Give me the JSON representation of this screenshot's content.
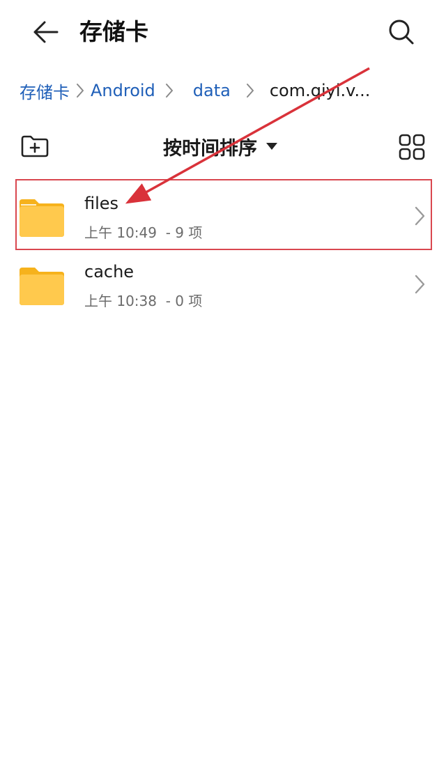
{
  "header": {
    "title": "存储卡",
    "back_icon": "arrow-left-icon",
    "search_icon": "search-icon"
  },
  "breadcrumb": {
    "items": [
      {
        "label": "存储卡"
      },
      {
        "label": "Android"
      },
      {
        "label": "data"
      },
      {
        "label": "com.qiyi.v..."
      }
    ]
  },
  "toolbar": {
    "sort_label": "按时间排序",
    "new_folder_icon": "new-folder-icon",
    "grid_icon": "grid-view-icon"
  },
  "folders": [
    {
      "name": "files",
      "time": "上午 10:49",
      "count": "- 9 项"
    },
    {
      "name": "cache",
      "time": "上午 10:38",
      "count": "- 0 项"
    }
  ],
  "colors": {
    "link": "#1f5fb8",
    "folder": "#ffc94d",
    "annotation": "#d9474f"
  }
}
